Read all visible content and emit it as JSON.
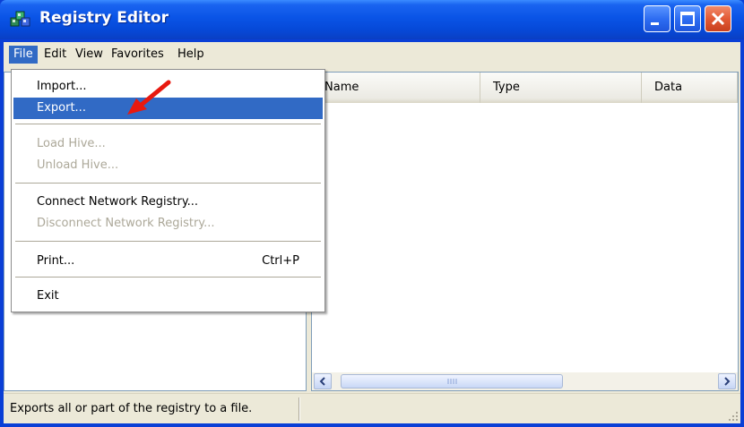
{
  "window": {
    "title": "Registry Editor",
    "icon": "registry-cubes-icon",
    "controls": [
      "minimize-icon",
      "maximize-icon",
      "close-icon"
    ]
  },
  "menubar": {
    "items": [
      {
        "label": "File",
        "active": true
      },
      {
        "label": "Edit"
      },
      {
        "label": "View"
      },
      {
        "label": "Favorites"
      },
      {
        "label": "Help"
      }
    ]
  },
  "file_menu": {
    "items": [
      {
        "label": "Import...",
        "state": "enabled"
      },
      {
        "label": "Export...",
        "state": "highlighted"
      },
      {
        "label": "Load Hive...",
        "state": "disabled"
      },
      {
        "label": "Unload Hive...",
        "state": "disabled"
      },
      {
        "label": "Connect Network Registry...",
        "state": "enabled"
      },
      {
        "label": "Disconnect Network Registry...",
        "state": "disabled"
      },
      {
        "label": "Print...",
        "shortcut": "Ctrl+P",
        "state": "enabled"
      },
      {
        "label": "Exit",
        "state": "enabled"
      }
    ]
  },
  "list": {
    "columns": [
      "Name",
      "Type",
      "Data"
    ]
  },
  "statusbar": {
    "text": "Exports all or part of the registry to a file."
  },
  "colors": {
    "title_blue": "#0a54e6",
    "selection": "#316ac5",
    "chrome": "#ece9d8",
    "annotation_arrow": "#e8190f"
  }
}
